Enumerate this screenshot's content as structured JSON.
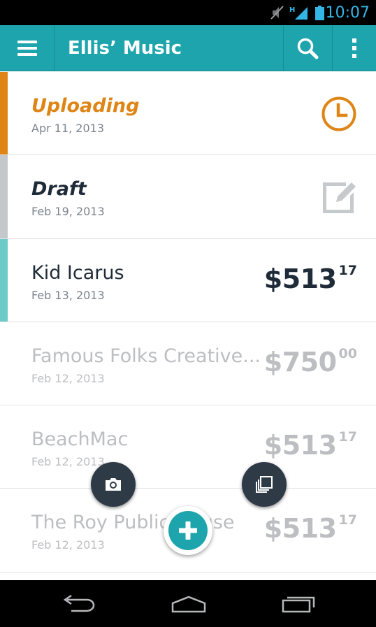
{
  "status_bar": {
    "time": "10:07",
    "signal_letter": "H",
    "icons": [
      "mute-icon",
      "signal-icon",
      "battery-icon"
    ]
  },
  "app_bar": {
    "title": "Ellis’ Music",
    "background_color": "#1da4ac",
    "icons": [
      "menu-icon",
      "search-icon",
      "overflow-menu-icon"
    ]
  },
  "items": [
    {
      "title": "Uploading",
      "date": "Apr 11, 2013",
      "status": "uploading",
      "stripe_color": "#de8516",
      "icon": "clock-icon"
    },
    {
      "title": "Draft",
      "date": "Feb 19, 2013",
      "status": "draft",
      "stripe_color": "#c4c8cb",
      "icon": "edit-icon"
    },
    {
      "title": "Kid Icarus",
      "date": "Feb 13, 2013",
      "amount": "$513",
      "cents": "17",
      "stripe_color": "#6ccbc8"
    },
    {
      "title": "Famous Folks Creative...",
      "date": "Feb 12, 2013",
      "amount": "$750",
      "cents": "00"
    },
    {
      "title": "BeachMac",
      "date": "Feb 12, 2013",
      "amount": "$513",
      "cents": "17"
    },
    {
      "title": "The Roy Public House",
      "date": "Feb 12, 2013",
      "amount": "$513",
      "cents": "17"
    }
  ],
  "fabs": [
    "camera-icon",
    "copy-icon",
    "add-icon"
  ],
  "nav_bar": {
    "icons": [
      "back-icon",
      "home-icon",
      "recents-icon"
    ]
  },
  "colors": {
    "accent": "#1da4ac",
    "uploading": "#de8516",
    "primary_text": "#1f2b38",
    "faded_text": "#bcbec1",
    "fab_dark": "#2e3b47"
  }
}
